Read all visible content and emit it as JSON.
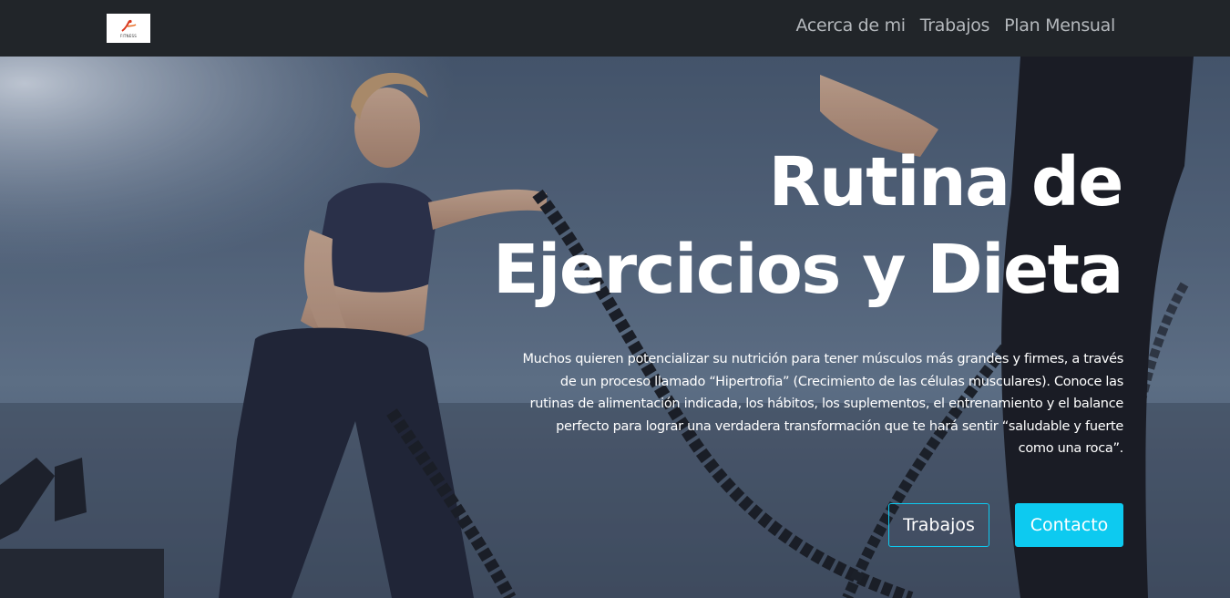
{
  "navbar": {
    "logo_text": "FITNESS",
    "links": [
      "Acerca de mi",
      "Trabajos",
      "Plan Mensual"
    ]
  },
  "hero": {
    "title_line1": "Rutina de",
    "title_line2": "Ejercicios y Dieta",
    "description": "Muchos quieren potencializar su nutrición para tener músculos más grandes y firmes, a través de un proceso llamado “Hipertrofia” (Crecimiento de las células musculares). Conoce las rutinas de alimentación indicada, los hábitos, los suplementos, el entrenamiento y el balance perfecto para lograr una verdadera transformación que te hará sentir “saludable y fuerte como una roca”.",
    "buttons": {
      "secondary_label": "Trabajos",
      "primary_label": "Contacto"
    }
  },
  "colors": {
    "navbar_bg": "#212529",
    "accent": "#0dcaf0",
    "nav_link": "#b4b8bc"
  }
}
